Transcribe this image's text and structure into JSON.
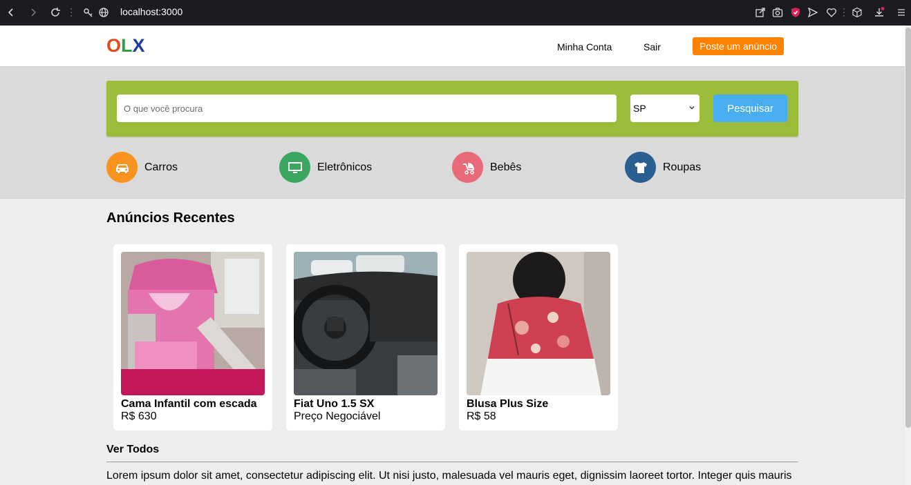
{
  "browser": {
    "url": "localhost:3000"
  },
  "header": {
    "logo": {
      "o": "O",
      "l": "L",
      "x": "X"
    },
    "my_account": "Minha Conta",
    "logout": "Sair",
    "post_ad": "Poste um anúncio"
  },
  "search": {
    "placeholder": "O que você procura",
    "state_selected": "SP",
    "button": "Pesquisar"
  },
  "categories": [
    {
      "label": "Carros",
      "icon": "car-icon",
      "color": "#f7931e"
    },
    {
      "label": "Eletrônicos",
      "icon": "monitor-icon",
      "color": "#3aa660"
    },
    {
      "label": "Bebês",
      "icon": "stroller-icon",
      "color": "#e86a78"
    },
    {
      "label": "Roupas",
      "icon": "shirt-icon",
      "color": "#2c5f91"
    }
  ],
  "recent": {
    "title": "Anúncios Recentes",
    "ads": [
      {
        "title": "Cama Infantil com escada",
        "price": "R$ 630"
      },
      {
        "title": "Fiat Uno 1.5 SX",
        "price": "Preço Negociável"
      },
      {
        "title": "Blusa Plus Size",
        "price": "R$ 58"
      }
    ],
    "see_all": "Ver Todos"
  },
  "footer_text": "Lorem ipsum dolor sit amet, consectetur adipiscing elit. Ut nisi justo, malesuada vel mauris eget, dignissim laoreet tortor. Integer quis mauris"
}
